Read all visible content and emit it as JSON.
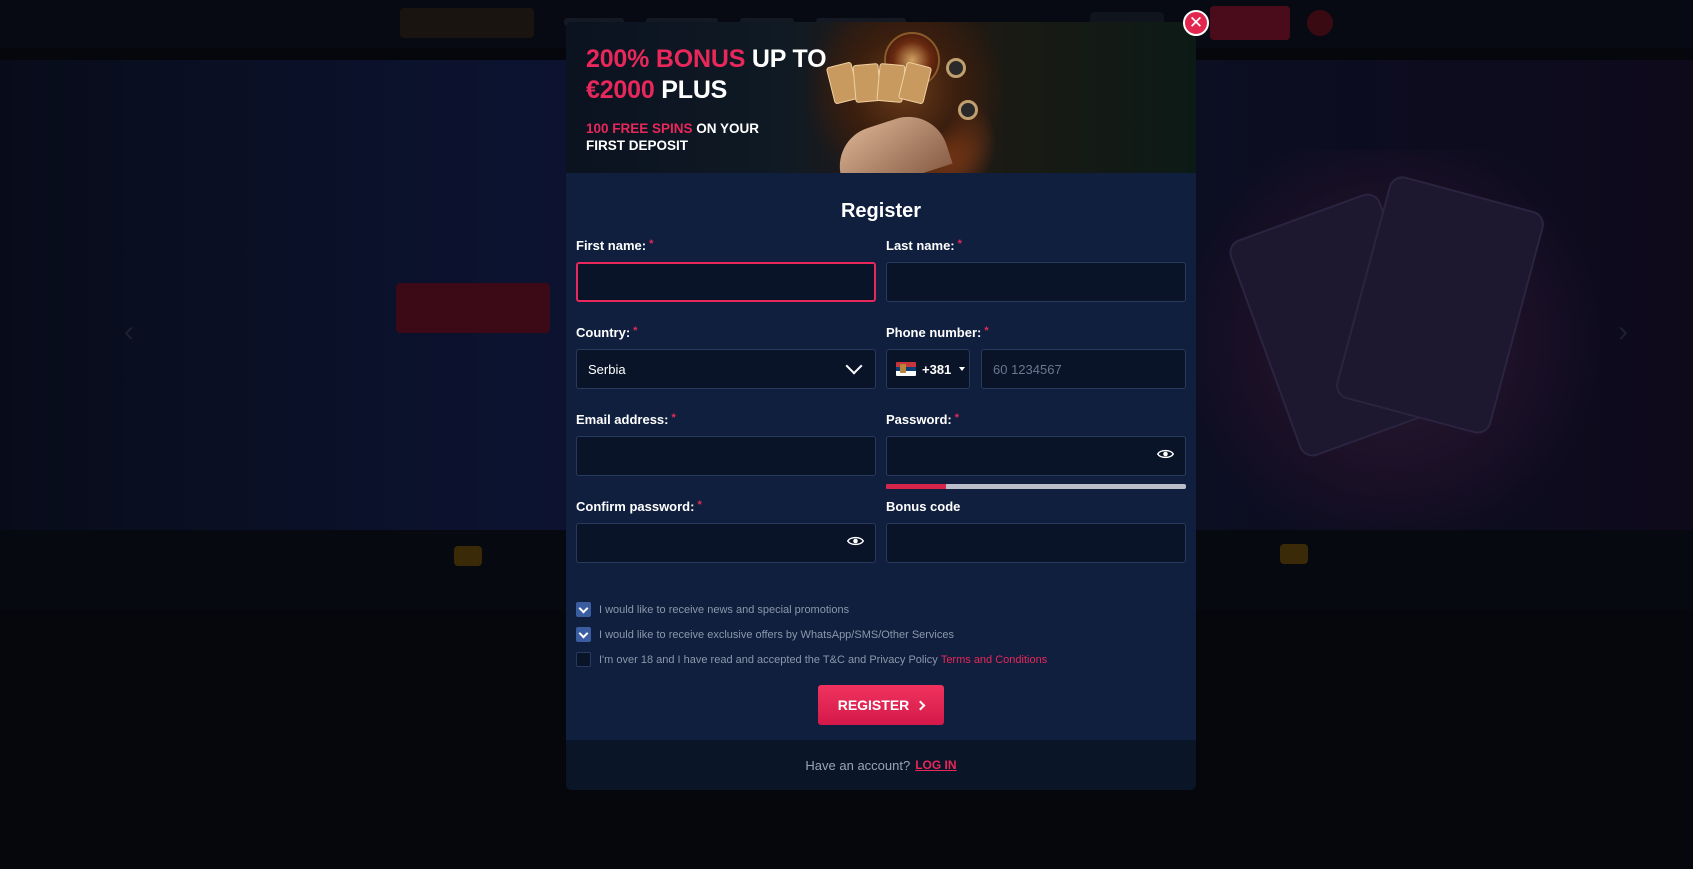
{
  "promo": {
    "line1_red": "200% BONUS",
    "line1_white": " UP TO",
    "line2_red": "€2000",
    "line2_white": " PLUS",
    "sub1_red": "100 FREE SPINS",
    "sub1_white": " ON YOUR",
    "sub2": "FIRST DEPOSIT"
  },
  "form": {
    "title": "Register",
    "required_mark": "*",
    "first_name_label": "First name:",
    "last_name_label": "Last name:",
    "country_label": "Country:",
    "country_value": "Serbia",
    "phone_label": "Phone number:",
    "phone_code": "+381",
    "phone_placeholder": "60 1234567",
    "email_label": "Email address:",
    "password_label": "Password:",
    "password_strength": 0.2,
    "confirm_password_label": "Confirm password:",
    "bonus_code_label": "Bonus code",
    "checkboxes": [
      {
        "text": "I would like to receive news and special promotions",
        "checked": true
      },
      {
        "text": "I would like to receive exclusive offers by WhatsApp/SMS/Other Services",
        "checked": true
      },
      {
        "text": "I'm over 18 and I have read and accepted the T&C and Privacy Policy",
        "checked": false,
        "link": "Terms and Conditions"
      }
    ],
    "register_button": "REGISTER",
    "have_account_text": "Have an account?",
    "login_link": "LOG IN"
  },
  "colors": {
    "accent": "#e8275a",
    "modal_bg": "#0f1f3d",
    "input_bg": "#0a1428"
  },
  "icons": {
    "close": "close-icon",
    "select": "chevron-down-icon",
    "password_toggle": "eye-icon",
    "button_arrow": "chevron-right-icon"
  }
}
